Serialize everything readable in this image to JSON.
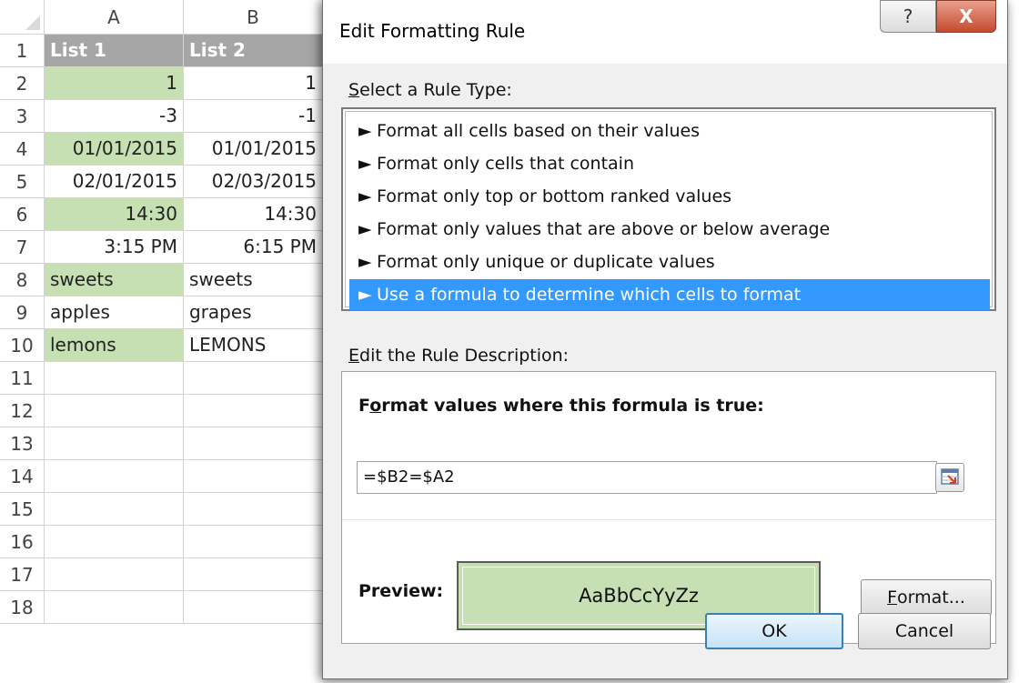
{
  "sheet": {
    "column_headers": [
      "A",
      "B"
    ],
    "row_headers": [
      "1",
      "2",
      "3",
      "4",
      "5",
      "6",
      "7",
      "8",
      "9",
      "10",
      "11",
      "12",
      "13",
      "14",
      "15",
      "16",
      "17",
      "18"
    ],
    "rows": [
      [
        {
          "v": "List 1",
          "t": "hdr"
        },
        {
          "v": "List 2",
          "t": "hdr"
        }
      ],
      [
        {
          "v": "1",
          "t": "num",
          "g": true
        },
        {
          "v": "1",
          "t": "num"
        }
      ],
      [
        {
          "v": "-3",
          "t": "num"
        },
        {
          "v": "-1",
          "t": "num"
        }
      ],
      [
        {
          "v": "01/01/2015",
          "t": "num",
          "g": true
        },
        {
          "v": "01/01/2015",
          "t": "num"
        }
      ],
      [
        {
          "v": "02/01/2015",
          "t": "num"
        },
        {
          "v": "02/03/2015",
          "t": "num"
        }
      ],
      [
        {
          "v": "14:30",
          "t": "num",
          "g": true
        },
        {
          "v": "14:30",
          "t": "num"
        }
      ],
      [
        {
          "v": "3:15 PM",
          "t": "num"
        },
        {
          "v": "6:15 PM",
          "t": "num"
        }
      ],
      [
        {
          "v": "sweets",
          "t": "text",
          "g": true
        },
        {
          "v": "sweets",
          "t": "text"
        }
      ],
      [
        {
          "v": "apples",
          "t": "text"
        },
        {
          "v": "grapes",
          "t": "text"
        }
      ],
      [
        {
          "v": "lemons",
          "t": "text",
          "g": true
        },
        {
          "v": "LEMONS",
          "t": "text"
        }
      ]
    ]
  },
  "dialog": {
    "title": "Edit Formatting Rule",
    "help_glyph": "?",
    "close_glyph": "X",
    "select_rule_type_label_accel": "S",
    "select_rule_type_label_rest": "elect a Rule Type:",
    "rule_types": [
      "Format all cells based on their values",
      "Format only cells that contain",
      "Format only top or bottom ranked values",
      "Format only values that are above or below average",
      "Format only unique or duplicate values",
      "Use a formula to determine which cells to format"
    ],
    "selected_rule_index": 5,
    "rule_arrow": "►",
    "edit_description_label_accel": "E",
    "edit_description_label_rest": "dit the Rule Description:",
    "formula_label_pre": "F",
    "formula_label_accel": "o",
    "formula_label_rest": "rmat values where this formula is true:",
    "formula_value": "=$B2=$A2",
    "preview_label": "Preview:",
    "preview_text": "AaBbCcYyZz",
    "preview_fill_color": "#c6e0b4",
    "format_button_accel": "F",
    "format_button_rest": "ormat...",
    "ok_label": "OK",
    "cancel_label": "Cancel"
  },
  "icons": {
    "range_select": "collapse-dialog-icon",
    "list_bullet": "triangle-right-icon"
  },
  "colors": {
    "header_fill": "#a6a6a6",
    "highlight_fill": "#c6e0b4",
    "selection_blue": "#3399ff"
  }
}
